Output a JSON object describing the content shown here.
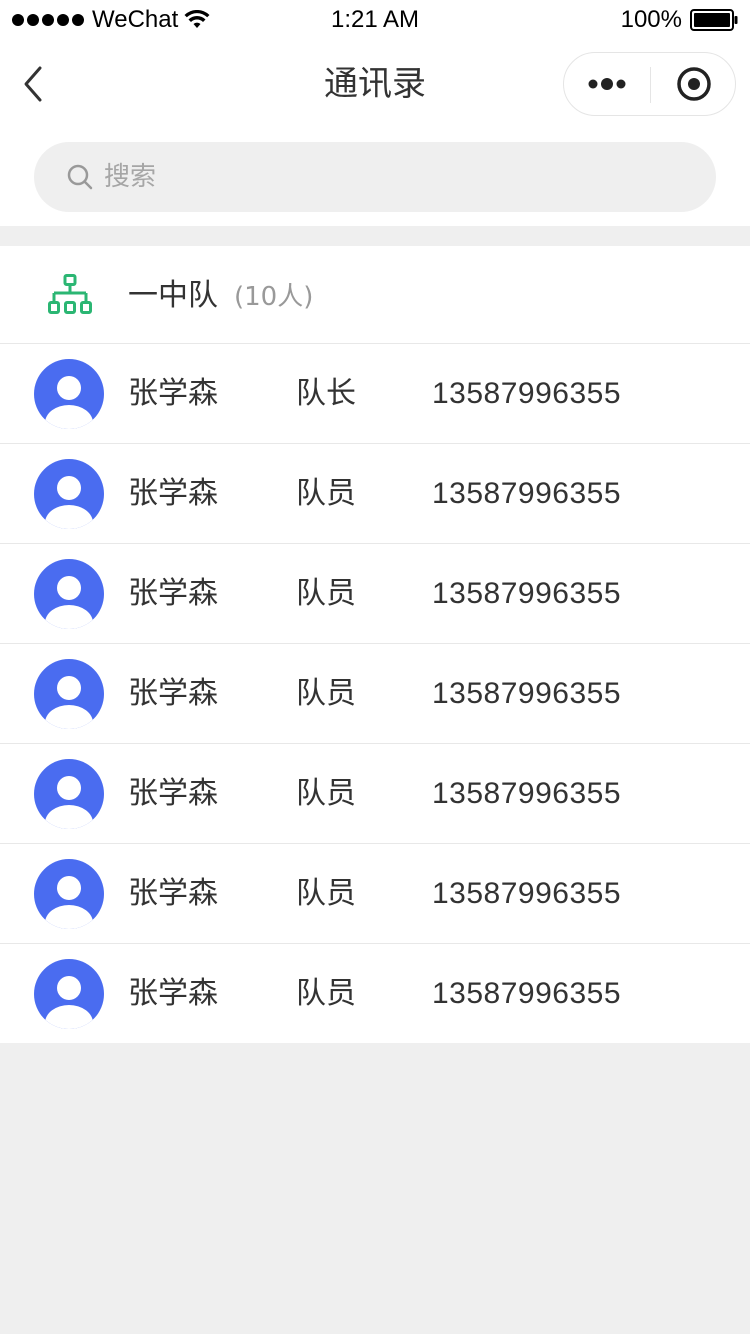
{
  "status_bar": {
    "carrier": "WeChat",
    "time": "1:21 AM",
    "battery": "100%"
  },
  "nav": {
    "title": "通讯录"
  },
  "search": {
    "placeholder": "搜索"
  },
  "group": {
    "name": "一中队",
    "count": "(10人)"
  },
  "members": [
    {
      "name": "张学森",
      "role": "队长",
      "phone": "13587996355"
    },
    {
      "name": "张学森",
      "role": "队员",
      "phone": "13587996355"
    },
    {
      "name": "张学森",
      "role": "队员",
      "phone": "13587996355"
    },
    {
      "name": "张学森",
      "role": "队员",
      "phone": "13587996355"
    },
    {
      "name": "张学森",
      "role": "队员",
      "phone": "13587996355"
    },
    {
      "name": "张学森",
      "role": "队员",
      "phone": "13587996355"
    },
    {
      "name": "张学森",
      "role": "队员",
      "phone": "13587996355"
    }
  ],
  "icons": {
    "back": "chevron-left-icon",
    "more": "more-dots-icon",
    "close": "target-icon",
    "search": "search-icon",
    "org": "org-chart-icon",
    "avatar": "user-avatar-icon"
  },
  "colors": {
    "avatar_bg": "#4a6cf0",
    "org_icon": "#2bb673",
    "page_bg": "#efefef"
  }
}
